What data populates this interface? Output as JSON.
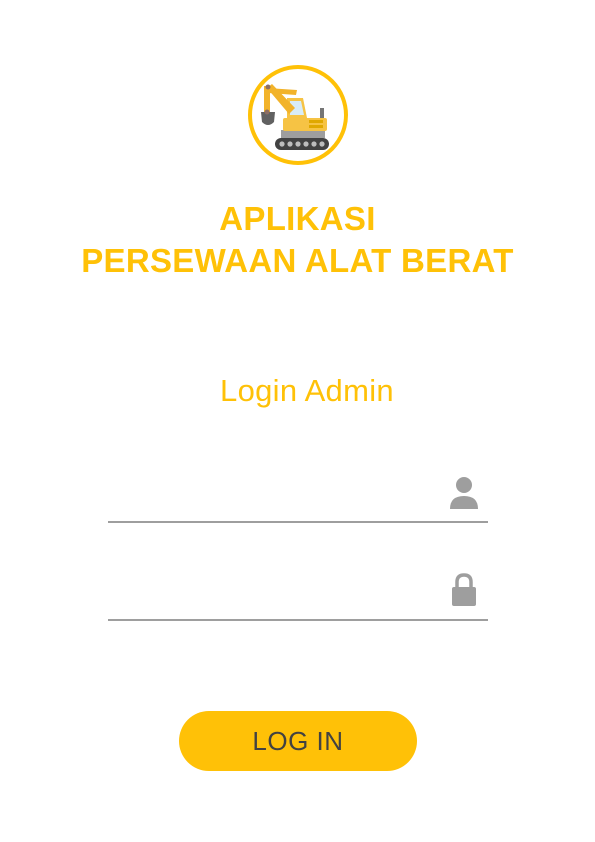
{
  "app": {
    "title_line1": "APLIKASI",
    "title_line2": "PERSEWAAN ALAT BERAT",
    "accent_color": "#ffc107",
    "logo_icon": "excavator-icon"
  },
  "login": {
    "heading": "Login Admin",
    "username": {
      "value": "",
      "placeholder": "",
      "icon": "user-icon"
    },
    "password": {
      "value": "",
      "placeholder": "",
      "icon": "lock-icon"
    },
    "button_label": "LOG IN"
  }
}
